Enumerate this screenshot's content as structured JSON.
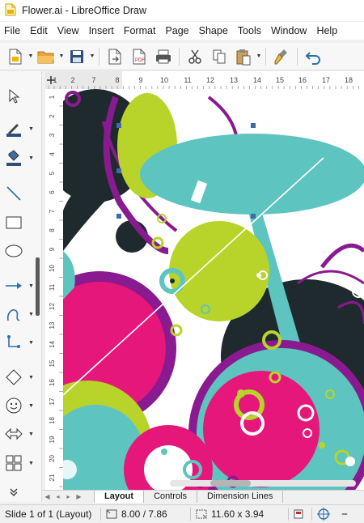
{
  "window": {
    "title": "Flower.ai - LibreOffice Draw",
    "app_icon": "draw-app-icon"
  },
  "menu": [
    "File",
    "Edit",
    "View",
    "Insert",
    "Format",
    "Page",
    "Shape",
    "Tools",
    "Window",
    "Help"
  ],
  "toolbar": {
    "buttons": [
      "new-document-icon",
      "open-folder-icon",
      "save-icon",
      "export-icon",
      "export-pdf-icon",
      "print-icon",
      "cut-icon",
      "copy-icon",
      "paste-icon",
      "clone-formatting-icon",
      "undo-icon"
    ]
  },
  "drawing_tools": [
    "select-arrow-icon",
    "line-color-icon",
    "fill-color-icon",
    "line-tool-icon",
    "rectangle-tool-icon",
    "ellipse-tool-icon",
    "arrow-line-icon",
    "curve-tool-icon",
    "connector-tool-icon",
    "diamond-shape-icon",
    "smiley-symbol-icon",
    "double-arrow-icon",
    "flowchart-icon",
    "more-tools-icon"
  ],
  "ruler": {
    "h_labels": [
      "1",
      "2",
      "7",
      "8",
      "9",
      "10",
      "11",
      "12",
      "13",
      "14",
      "15",
      "16",
      "17",
      "18"
    ],
    "v_labels": [
      "1",
      "2",
      "3",
      "4",
      "5",
      "6",
      "7",
      "8",
      "9",
      "10",
      "11",
      "12",
      "13",
      "14",
      "15",
      "16",
      "17",
      "18",
      "19",
      "20",
      "21"
    ]
  },
  "tabs": {
    "items": [
      "Layout",
      "Controls",
      "Dimension Lines"
    ],
    "active": "Layout"
  },
  "status": {
    "slide": "Slide 1 of 1 (Layout)",
    "position": "8.00 / 7.86",
    "size": "11.60 x 3.94"
  },
  "colors": {
    "magenta": "#e5177a",
    "teal": "#5ec4c0",
    "lime": "#b8d42a",
    "purple": "#8a1a8f",
    "dark": "#1f2a2e",
    "selection": "#3f6aa6",
    "accent_blue": "#2a6eb0"
  }
}
